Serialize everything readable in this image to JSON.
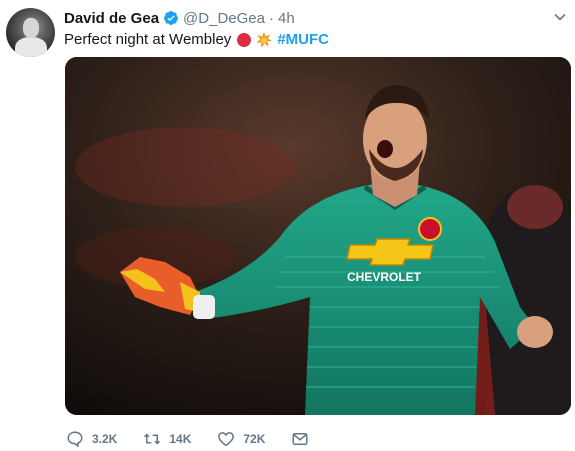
{
  "tweet": {
    "author": {
      "name": "David de Gea",
      "handle": "@D_DeGea",
      "verified": true,
      "avatar_icon": "profile-photo"
    },
    "separator": "·",
    "timestamp": "4h",
    "text": {
      "body": "Perfect night at Wembley",
      "emoji": [
        "red-circle-emoji",
        "collision-emoji"
      ],
      "hashtag": "#MUFC"
    },
    "media": {
      "kind": "photo",
      "jersey_text": "CHEVROLET"
    },
    "actions": {
      "replies": "3.2K",
      "retweets": "14K",
      "likes": "72K",
      "dm_icon": "envelope-icon"
    }
  },
  "colors": {
    "link": "#1da1f2",
    "text_primary": "#14171a",
    "text_secondary": "#657786",
    "jersey": "#1f9f84"
  }
}
